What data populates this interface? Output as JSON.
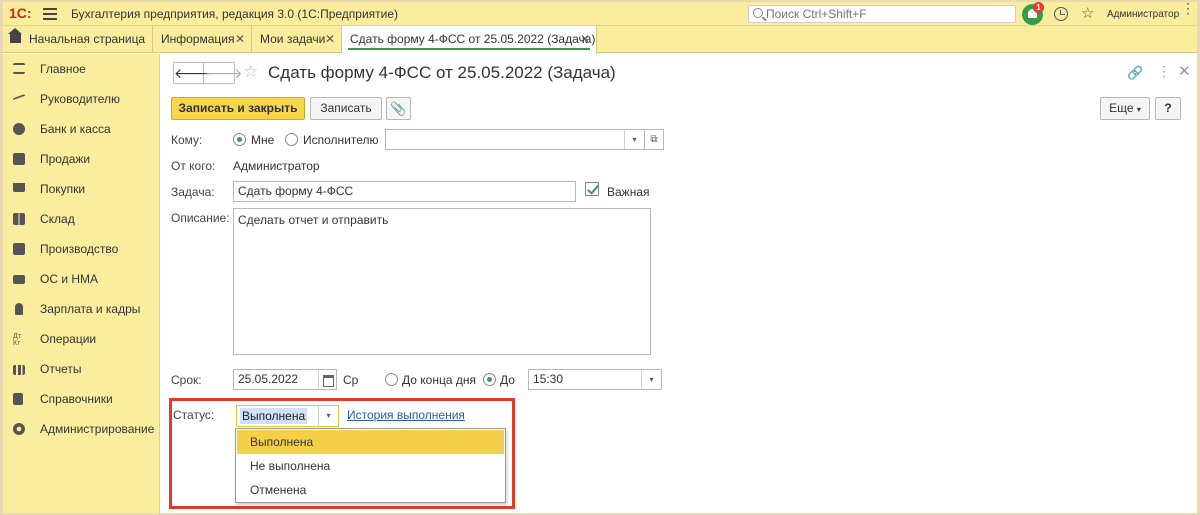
{
  "app": {
    "logo": "1С:",
    "title": "Бухгалтерия предприятия, редакция 3.0  (1С:Предприятие)",
    "search_placeholder": "Поиск Ctrl+Shift+F",
    "notification_count": "1",
    "user": "Администратор"
  },
  "tabs": [
    {
      "label": "Начальная страница"
    },
    {
      "label": "Информация"
    },
    {
      "label": "Мои задачи"
    },
    {
      "label": "Сдать форму 4-ФСС от 25.05.2022 (Задача)"
    }
  ],
  "sidebar": {
    "items": [
      {
        "label": "Главное",
        "icon": "menu-icon"
      },
      {
        "label": "Руководителю",
        "icon": "chart-trend-icon"
      },
      {
        "label": "Банк и касса",
        "icon": "ruble-icon"
      },
      {
        "label": "Продажи",
        "icon": "bag-icon"
      },
      {
        "label": "Покупки",
        "icon": "cart-icon"
      },
      {
        "label": "Склад",
        "icon": "warehouse-icon"
      },
      {
        "label": "Производство",
        "icon": "factory-icon"
      },
      {
        "label": "ОС и НМА",
        "icon": "truck-icon"
      },
      {
        "label": "Зарплата и кадры",
        "icon": "person-icon"
      },
      {
        "label": "Операции",
        "icon": "dt-kt-icon"
      },
      {
        "label": "Отчеты",
        "icon": "bar-chart-icon"
      },
      {
        "label": "Справочники",
        "icon": "books-icon"
      },
      {
        "label": "Администрирование",
        "icon": "gear-icon"
      }
    ]
  },
  "form": {
    "title": "Сдать форму 4-ФСС от 25.05.2022 (Задача)",
    "buttons": {
      "save_close": "Записать и закрыть",
      "save": "Записать",
      "more": "Еще",
      "help": "?"
    },
    "komu_label": "Кому:",
    "radio_me": "Мне",
    "radio_executor": "Исполнителю",
    "executor_value": "",
    "ot_kogo_label": "От кого:",
    "ot_kogo_value": "Администратор",
    "zadacha_label": "Задача:",
    "zadacha_value": "Сдать форму 4-ФСС",
    "important_label": "Важная",
    "opisanie_label": "Описание:",
    "opisanie_value": "Сделать отчет и отправить",
    "srok_label": "Срок:",
    "srok_date": "25.05.2022",
    "srok_weekday": "Ср",
    "radio_end_of_day": "До конца дня",
    "radio_until": "До",
    "srok_time": "15:30",
    "status_label": "Статус:",
    "status_value": "Выполнена",
    "history_link": "История выполнения",
    "status_options": [
      "Выполнена",
      "Не выполнена",
      "Отменена"
    ]
  },
  "colors": {
    "panel": "#fbed9e",
    "accent": "#f6d64a",
    "highlight": "#e03a2b",
    "green": "#3b9a48"
  }
}
